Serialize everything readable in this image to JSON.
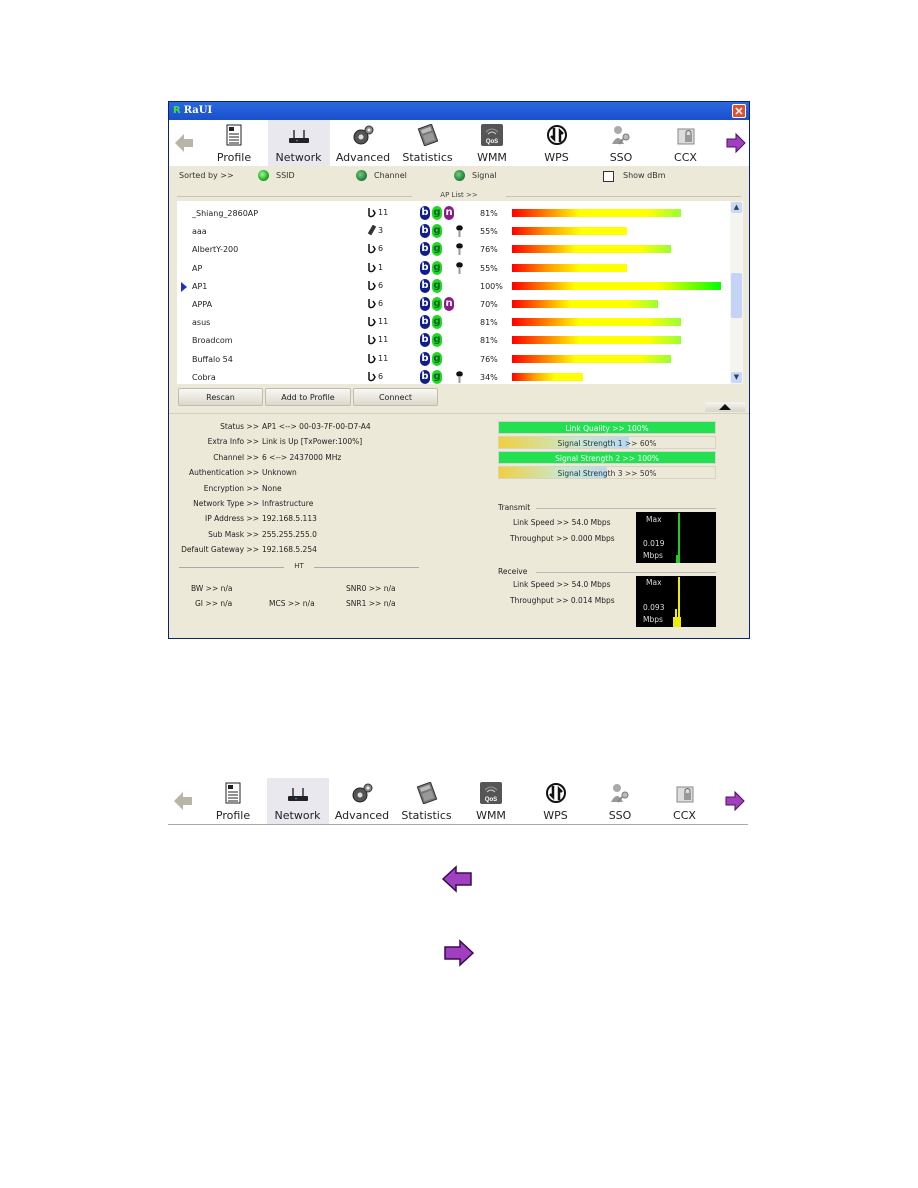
{
  "window": {
    "title": "RaUI",
    "logo_glyph": "R",
    "close_glyph": "✕"
  },
  "toolbar": {
    "back_icon": "left-arrow-gray-icon",
    "forward_icon": "right-arrow-purple-icon",
    "items": [
      {
        "label": "Profile",
        "icon": "profile-document-icon",
        "active": false
      },
      {
        "label": "Network",
        "icon": "router-icon",
        "active": true
      },
      {
        "label": "Advanced",
        "icon": "gears-icon",
        "active": false
      },
      {
        "label": "Statistics",
        "icon": "calculator-icon",
        "active": false
      },
      {
        "label": "WMM",
        "icon": "qos-signal-icon",
        "active": false
      },
      {
        "label": "WPS",
        "icon": "wps-arrows-icon",
        "active": false
      },
      {
        "label": "SSO",
        "icon": "user-key-icon",
        "active": false
      },
      {
        "label": "CCX",
        "icon": "folder-lock-icon",
        "active": false
      }
    ]
  },
  "sortbar": {
    "label": "Sorted by >>",
    "options": [
      {
        "label": "SSID",
        "selected": true
      },
      {
        "label": "Channel",
        "selected": false
      },
      {
        "label": "Signal",
        "selected": false
      }
    ],
    "show_dbm_label": "Show dBm",
    "show_dbm_checked": false
  },
  "ap_list": {
    "title": "AP List >>",
    "rows": [
      {
        "ssid": "_Shiang_2860AP",
        "channel": "11",
        "channel_icon": "infrastructure-icon",
        "b": true,
        "g": true,
        "n": true,
        "secured": false,
        "signal_pct": 81,
        "signal_label": "81%",
        "selected": false
      },
      {
        "ssid": "aaa",
        "channel": "3",
        "channel_icon": "adhoc-icon",
        "b": true,
        "g": true,
        "n": false,
        "secured": true,
        "signal_pct": 55,
        "signal_label": "55%",
        "selected": false
      },
      {
        "ssid": "AlbertY-200",
        "channel": "6",
        "channel_icon": "infrastructure-icon",
        "b": true,
        "g": true,
        "n": false,
        "secured": true,
        "signal_pct": 76,
        "signal_label": "76%",
        "selected": false
      },
      {
        "ssid": "AP",
        "channel": "1",
        "channel_icon": "infrastructure-icon",
        "b": true,
        "g": true,
        "n": false,
        "secured": true,
        "signal_pct": 55,
        "signal_label": "55%",
        "selected": false
      },
      {
        "ssid": "AP1",
        "channel": "6",
        "channel_icon": "infrastructure-icon",
        "b": true,
        "g": true,
        "n": false,
        "secured": false,
        "signal_pct": 100,
        "signal_label": "100%",
        "selected": true
      },
      {
        "ssid": "APPA",
        "channel": "6",
        "channel_icon": "infrastructure-icon",
        "b": true,
        "g": true,
        "n": true,
        "secured": false,
        "signal_pct": 70,
        "signal_label": "70%",
        "selected": false
      },
      {
        "ssid": "asus",
        "channel": "11",
        "channel_icon": "infrastructure-icon",
        "b": true,
        "g": true,
        "n": false,
        "secured": false,
        "signal_pct": 81,
        "signal_label": "81%",
        "selected": false
      },
      {
        "ssid": "Broadcom",
        "channel": "11",
        "channel_icon": "infrastructure-icon",
        "b": true,
        "g": true,
        "n": false,
        "secured": false,
        "signal_pct": 81,
        "signal_label": "81%",
        "selected": false
      },
      {
        "ssid": "Buffalo 54",
        "channel": "11",
        "channel_icon": "infrastructure-icon",
        "b": true,
        "g": true,
        "n": false,
        "secured": false,
        "signal_pct": 76,
        "signal_label": "76%",
        "selected": false
      },
      {
        "ssid": "Cobra",
        "channel": "6",
        "channel_icon": "infrastructure-icon",
        "b": true,
        "g": true,
        "n": false,
        "secured": true,
        "signal_pct": 34,
        "signal_label": "34%",
        "selected": false
      }
    ],
    "badge_labels": {
      "b": "b",
      "g": "g",
      "n": "n"
    }
  },
  "buttons": {
    "rescan": "Rescan",
    "add_to_profile": "Add to Profile",
    "connect": "Connect"
  },
  "info": [
    {
      "key": "Status >>",
      "value": "AP1 <--> 00-03-7F-00-D7-A4"
    },
    {
      "key": "Extra Info >>",
      "value": "Link is Up [TxPower:100%]"
    },
    {
      "key": "Channel >>",
      "value": "6 <--> 2437000 MHz"
    },
    {
      "key": "Authentication >>",
      "value": "Unknown"
    },
    {
      "key": "Encryption >>",
      "value": "None"
    },
    {
      "key": "Network Type >>",
      "value": "Infrastructure"
    },
    {
      "key": "IP Address >>",
      "value": "192.168.5.113"
    },
    {
      "key": "Sub Mask >>",
      "value": "255.255.255.0"
    },
    {
      "key": "Default Gateway >>",
      "value": "192.168.5.254"
    }
  ],
  "ht": {
    "title": "HT",
    "bw": "BW >> n/a",
    "gi": "GI >> n/a",
    "mcs": "MCS >> n/a",
    "snr0": "SNR0 >> n/a",
    "snr1": "SNR1 >> n/a"
  },
  "quality": [
    {
      "label": "Link Quality >> 100%",
      "value": 100
    },
    {
      "label": "Signal Strength 1 >> 60%",
      "value": 60
    },
    {
      "label": "Signal Strength 2 >> 100%",
      "value": 100
    },
    {
      "label": "Signal Strength 3 >> 50%",
      "value": 50
    }
  ],
  "transmit": {
    "title": "Transmit",
    "link_speed": "Link Speed >> 54.0 Mbps",
    "throughput": "Throughput >> 0.000 Mbps",
    "graph_max": "Max",
    "graph_value": "0.019",
    "graph_unit": "Mbps",
    "graph_color": "#22cc22"
  },
  "receive": {
    "title": "Receive",
    "link_speed": "Link Speed >> 54.0 Mbps",
    "throughput": "Throughput >> 0.014 Mbps",
    "graph_max": "Max",
    "graph_value": "0.093",
    "graph_unit": "Mbps",
    "graph_color": "#eeee00"
  },
  "colors": {
    "title_bar": "#1a4fcb",
    "badge_b": "#101e8a",
    "badge_g": "#25d625",
    "badge_n": "#8a1a8a",
    "arrow_purple": "#a040c0",
    "quality_green": "#22e052",
    "window_bg": "#ece9d8"
  }
}
